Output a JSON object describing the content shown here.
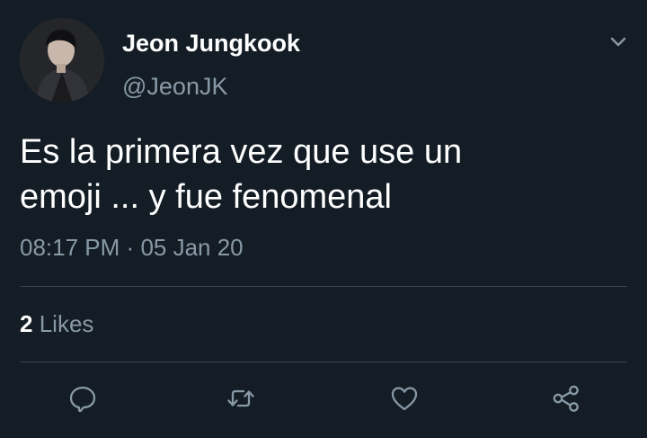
{
  "author": {
    "display_name": "Jeon Jungkook",
    "handle": "@JeonJK",
    "avatar_icon": "profile-photo-icon"
  },
  "tweet": {
    "text": "Es la primera vez que use un\nemoji ... y fue fenomenal",
    "time": "08:17 PM",
    "separator": "·",
    "date": "05 Jan 20"
  },
  "stats": {
    "likes_count": "2",
    "likes_label": "Likes"
  },
  "actions": {
    "reply_icon": "reply-icon",
    "retweet_icon": "retweet-icon",
    "like_icon": "heart-icon",
    "share_icon": "share-icon"
  },
  "colors": {
    "background": "#141d26",
    "text_primary": "#ffffff",
    "text_secondary": "#8899a6",
    "divider": "#38444d"
  }
}
